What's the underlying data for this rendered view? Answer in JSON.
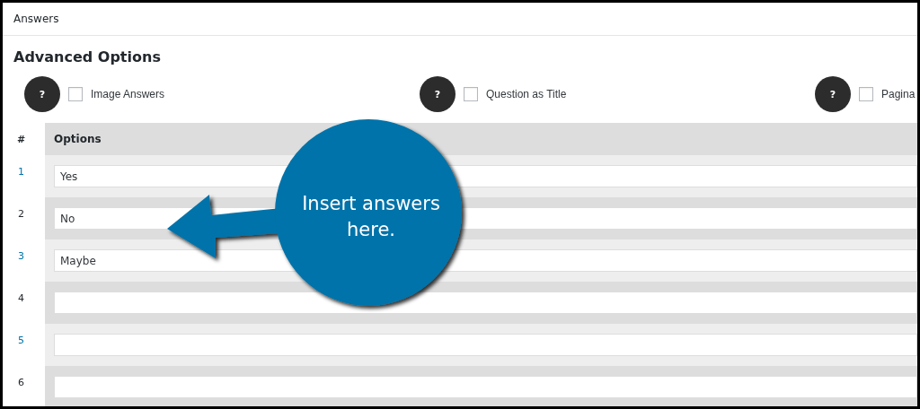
{
  "panel_title": "Answers",
  "section_title": "Advanced Options",
  "toggles": [
    {
      "help": "?",
      "label": "Image Answers",
      "checked": false
    },
    {
      "help": "?",
      "label": "Question as Title",
      "checked": false
    },
    {
      "help": "?",
      "label": "Pagina",
      "checked": false
    }
  ],
  "table": {
    "columns": [
      "#",
      "Options"
    ],
    "rows": [
      {
        "number": "1",
        "value": "Yes"
      },
      {
        "number": "2",
        "value": "No"
      },
      {
        "number": "3",
        "value": "Maybe"
      },
      {
        "number": "4",
        "value": ""
      },
      {
        "number": "5",
        "value": ""
      },
      {
        "number": "6",
        "value": ""
      }
    ]
  },
  "callout": {
    "text": "Insert answers here."
  }
}
